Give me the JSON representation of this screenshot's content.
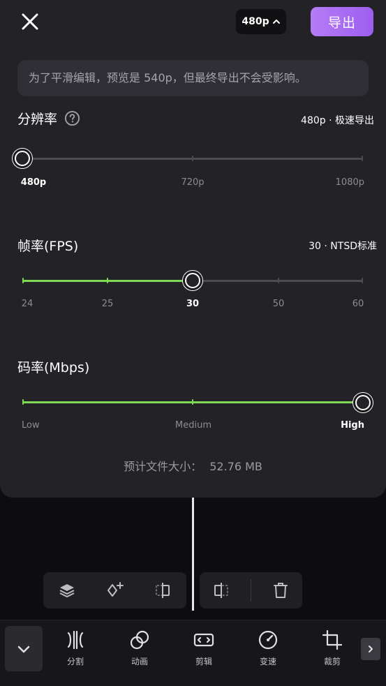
{
  "header": {
    "resolution_chip": "480p",
    "export_label": "导出"
  },
  "notice": "为了平滑编辑，预览是 540p，但最终导出不会受影响。",
  "resolution": {
    "title": "分辨率",
    "meta": "480p · 极速导出",
    "options": [
      "480p",
      "720p",
      "1080p"
    ],
    "selected": "480p"
  },
  "framerate": {
    "title": "帧率(FPS)",
    "meta": "30 · NTSD标准",
    "options": [
      "24",
      "25",
      "30",
      "50",
      "60"
    ],
    "selected": "30"
  },
  "bitrate": {
    "title": "码率(Mbps)",
    "options": [
      "Low",
      "Medium",
      "High"
    ],
    "selected": "High"
  },
  "filesize": {
    "label": "预计文件大小：",
    "value": "52.76 MB"
  },
  "toolbar": {
    "items": [
      {
        "label": "分割",
        "icon": "split-icon"
      },
      {
        "label": "动画",
        "icon": "animation-icon"
      },
      {
        "label": "剪辑",
        "icon": "trim-icon"
      },
      {
        "label": "变速",
        "icon": "speed-icon"
      },
      {
        "label": "裁剪",
        "icon": "crop-icon"
      }
    ]
  },
  "colors": {
    "accent_green": "#7ed957",
    "export_purple": "#a366f2",
    "panel_bg": "#222227"
  }
}
